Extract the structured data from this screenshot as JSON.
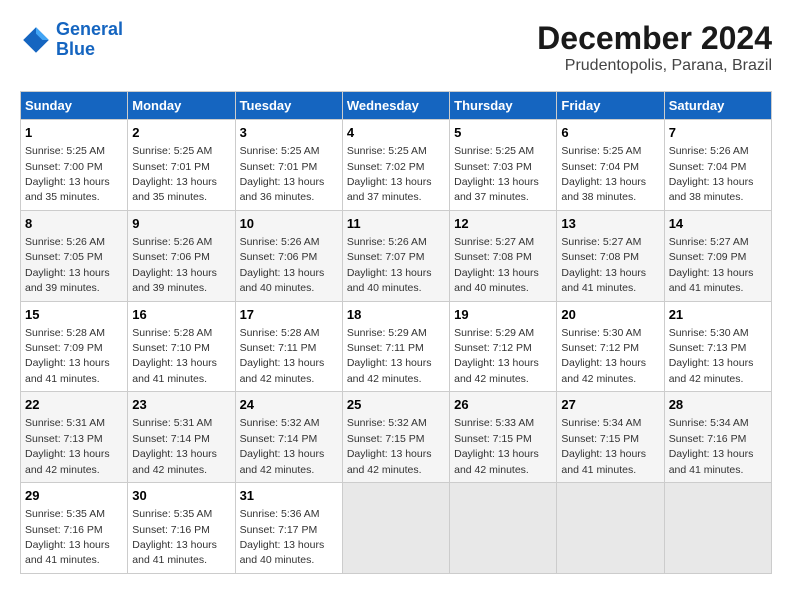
{
  "header": {
    "logo_line1": "General",
    "logo_line2": "Blue",
    "title": "December 2024",
    "subtitle": "Prudentopolis, Parana, Brazil"
  },
  "calendar": {
    "days_of_week": [
      "Sunday",
      "Monday",
      "Tuesday",
      "Wednesday",
      "Thursday",
      "Friday",
      "Saturday"
    ],
    "weeks": [
      [
        {
          "day": "1",
          "info": "Sunrise: 5:25 AM\nSunset: 7:00 PM\nDaylight: 13 hours\nand 35 minutes."
        },
        {
          "day": "2",
          "info": "Sunrise: 5:25 AM\nSunset: 7:01 PM\nDaylight: 13 hours\nand 35 minutes."
        },
        {
          "day": "3",
          "info": "Sunrise: 5:25 AM\nSunset: 7:01 PM\nDaylight: 13 hours\nand 36 minutes."
        },
        {
          "day": "4",
          "info": "Sunrise: 5:25 AM\nSunset: 7:02 PM\nDaylight: 13 hours\nand 37 minutes."
        },
        {
          "day": "5",
          "info": "Sunrise: 5:25 AM\nSunset: 7:03 PM\nDaylight: 13 hours\nand 37 minutes."
        },
        {
          "day": "6",
          "info": "Sunrise: 5:25 AM\nSunset: 7:04 PM\nDaylight: 13 hours\nand 38 minutes."
        },
        {
          "day": "7",
          "info": "Sunrise: 5:26 AM\nSunset: 7:04 PM\nDaylight: 13 hours\nand 38 minutes."
        }
      ],
      [
        {
          "day": "8",
          "info": "Sunrise: 5:26 AM\nSunset: 7:05 PM\nDaylight: 13 hours\nand 39 minutes."
        },
        {
          "day": "9",
          "info": "Sunrise: 5:26 AM\nSunset: 7:06 PM\nDaylight: 13 hours\nand 39 minutes."
        },
        {
          "day": "10",
          "info": "Sunrise: 5:26 AM\nSunset: 7:06 PM\nDaylight: 13 hours\nand 40 minutes."
        },
        {
          "day": "11",
          "info": "Sunrise: 5:26 AM\nSunset: 7:07 PM\nDaylight: 13 hours\nand 40 minutes."
        },
        {
          "day": "12",
          "info": "Sunrise: 5:27 AM\nSunset: 7:08 PM\nDaylight: 13 hours\nand 40 minutes."
        },
        {
          "day": "13",
          "info": "Sunrise: 5:27 AM\nSunset: 7:08 PM\nDaylight: 13 hours\nand 41 minutes."
        },
        {
          "day": "14",
          "info": "Sunrise: 5:27 AM\nSunset: 7:09 PM\nDaylight: 13 hours\nand 41 minutes."
        }
      ],
      [
        {
          "day": "15",
          "info": "Sunrise: 5:28 AM\nSunset: 7:09 PM\nDaylight: 13 hours\nand 41 minutes."
        },
        {
          "day": "16",
          "info": "Sunrise: 5:28 AM\nSunset: 7:10 PM\nDaylight: 13 hours\nand 41 minutes."
        },
        {
          "day": "17",
          "info": "Sunrise: 5:28 AM\nSunset: 7:11 PM\nDaylight: 13 hours\nand 42 minutes."
        },
        {
          "day": "18",
          "info": "Sunrise: 5:29 AM\nSunset: 7:11 PM\nDaylight: 13 hours\nand 42 minutes."
        },
        {
          "day": "19",
          "info": "Sunrise: 5:29 AM\nSunset: 7:12 PM\nDaylight: 13 hours\nand 42 minutes."
        },
        {
          "day": "20",
          "info": "Sunrise: 5:30 AM\nSunset: 7:12 PM\nDaylight: 13 hours\nand 42 minutes."
        },
        {
          "day": "21",
          "info": "Sunrise: 5:30 AM\nSunset: 7:13 PM\nDaylight: 13 hours\nand 42 minutes."
        }
      ],
      [
        {
          "day": "22",
          "info": "Sunrise: 5:31 AM\nSunset: 7:13 PM\nDaylight: 13 hours\nand 42 minutes."
        },
        {
          "day": "23",
          "info": "Sunrise: 5:31 AM\nSunset: 7:14 PM\nDaylight: 13 hours\nand 42 minutes."
        },
        {
          "day": "24",
          "info": "Sunrise: 5:32 AM\nSunset: 7:14 PM\nDaylight: 13 hours\nand 42 minutes."
        },
        {
          "day": "25",
          "info": "Sunrise: 5:32 AM\nSunset: 7:15 PM\nDaylight: 13 hours\nand 42 minutes."
        },
        {
          "day": "26",
          "info": "Sunrise: 5:33 AM\nSunset: 7:15 PM\nDaylight: 13 hours\nand 42 minutes."
        },
        {
          "day": "27",
          "info": "Sunrise: 5:34 AM\nSunset: 7:15 PM\nDaylight: 13 hours\nand 41 minutes."
        },
        {
          "day": "28",
          "info": "Sunrise: 5:34 AM\nSunset: 7:16 PM\nDaylight: 13 hours\nand 41 minutes."
        }
      ],
      [
        {
          "day": "29",
          "info": "Sunrise: 5:35 AM\nSunset: 7:16 PM\nDaylight: 13 hours\nand 41 minutes."
        },
        {
          "day": "30",
          "info": "Sunrise: 5:35 AM\nSunset: 7:16 PM\nDaylight: 13 hours\nand 41 minutes."
        },
        {
          "day": "31",
          "info": "Sunrise: 5:36 AM\nSunset: 7:17 PM\nDaylight: 13 hours\nand 40 minutes."
        },
        {
          "day": "",
          "info": ""
        },
        {
          "day": "",
          "info": ""
        },
        {
          "day": "",
          "info": ""
        },
        {
          "day": "",
          "info": ""
        }
      ]
    ]
  }
}
